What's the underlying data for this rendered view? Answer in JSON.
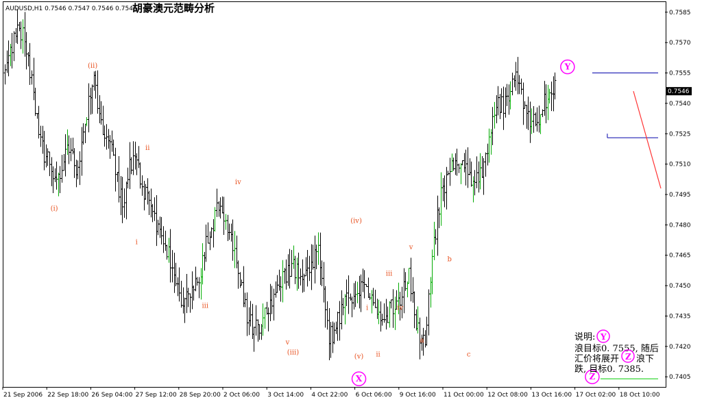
{
  "header": {
    "symbol_line": "AUDUSD,H1  0.7546 0.7547 0.7546 0.7546",
    "chinese_title": "胡豪澳元范畴分析"
  },
  "colors": {
    "background": "#ffffff",
    "bars": "#000000",
    "bull_bars": "#00aa00",
    "wave_labels": "#e8501e",
    "circle_labels": "#ff00ff",
    "box": "#0000aa",
    "forecast": "#ff3333",
    "target_line": "#00cc00"
  },
  "chart_data": {
    "type": "ohlc",
    "symbol": "AUDUSD",
    "timeframe": "H1",
    "ylim": [
      0.74,
      0.759
    ],
    "y_ticks": [
      "0.7585",
      "0.7570",
      "0.7555",
      "0.7540",
      "0.7525",
      "0.7510",
      "0.7495",
      "0.7480",
      "0.7465",
      "0.7450",
      "0.7435",
      "0.7420",
      "0.7405"
    ],
    "current_price": "0.7546",
    "x_ticks": [
      "21 Sep 2006",
      "22 Sep 18:00",
      "26 Sep 04:00",
      "27 Sep 12:00",
      "28 Sep 20:00",
      "2 Oct 06:00",
      "3 Oct 14:00",
      "4 Oct 22:00",
      "6 Oct 06:00",
      "9 Oct 16:00",
      "11 Oct 00:00",
      "12 Oct 08:00",
      "13 Oct 16:00",
      "17 Oct 02:00",
      "18 Oct 10:00"
    ],
    "bar_count": 310,
    "bull_color_note": "green bars mark up-closes",
    "price_path": [
      [
        0,
        0.7555
      ],
      [
        8,
        0.7575
      ],
      [
        14,
        0.7572
      ],
      [
        20,
        0.755
      ],
      [
        26,
        0.752
      ],
      [
        32,
        0.751
      ],
      [
        36,
        0.7498
      ],
      [
        40,
        0.7505
      ],
      [
        46,
        0.752
      ],
      [
        52,
        0.7505
      ],
      [
        58,
        0.753
      ],
      [
        64,
        0.7552
      ],
      [
        70,
        0.753
      ],
      [
        76,
        0.7522
      ],
      [
        82,
        0.75
      ],
      [
        86,
        0.7488
      ],
      [
        90,
        0.751
      ],
      [
        96,
        0.751
      ],
      [
        102,
        0.7495
      ],
      [
        108,
        0.7488
      ],
      [
        114,
        0.747
      ],
      [
        120,
        0.7465
      ],
      [
        124,
        0.745
      ],
      [
        130,
        0.7443
      ],
      [
        136,
        0.745
      ],
      [
        142,
        0.7456
      ],
      [
        146,
        0.747
      ],
      [
        150,
        0.7478
      ],
      [
        156,
        0.749
      ],
      [
        160,
        0.748
      ],
      [
        166,
        0.7468
      ],
      [
        172,
        0.745
      ],
      [
        176,
        0.7435
      ],
      [
        180,
        0.743
      ],
      [
        186,
        0.743
      ],
      [
        192,
        0.744
      ],
      [
        198,
        0.745
      ],
      [
        204,
        0.7455
      ],
      [
        210,
        0.7458
      ],
      [
        216,
        0.7455
      ],
      [
        222,
        0.746
      ],
      [
        228,
        0.747
      ],
      [
        232,
        0.7445
      ],
      [
        236,
        0.7425
      ],
      [
        240,
        0.7427
      ],
      [
        246,
        0.744
      ],
      [
        252,
        0.7445
      ],
      [
        258,
        0.745
      ],
      [
        264,
        0.7445
      ],
      [
        270,
        0.744
      ],
      [
        276,
        0.7432
      ],
      [
        282,
        0.744
      ],
      [
        288,
        0.7445
      ],
      [
        294,
        0.7458
      ],
      [
        300,
        0.743
      ],
      [
        306,
        0.742
      ],
      [
        312,
        0.747
      ],
      [
        318,
        0.7495
      ],
      [
        324,
        0.751
      ],
      [
        330,
        0.7512
      ],
      [
        336,
        0.7505
      ],
      [
        342,
        0.75
      ],
      [
        348,
        0.7505
      ],
      [
        354,
        0.753
      ],
      [
        360,
        0.754
      ],
      [
        366,
        0.754
      ],
      [
        372,
        0.7553
      ],
      [
        378,
        0.754
      ],
      [
        384,
        0.753
      ],
      [
        390,
        0.7535
      ],
      [
        396,
        0.7545
      ],
      [
        402,
        0.7548
      ]
    ],
    "wave_labels": [
      {
        "text": "(ii)",
        "t": 64,
        "y": 0.75575,
        "color": "orange"
      },
      {
        "text": "(i)",
        "t": 36,
        "y": 0.7487,
        "color": "orange"
      },
      {
        "text": "ii",
        "t": 104,
        "y": 0.7517,
        "color": "orange"
      },
      {
        "text": "i",
        "t": 96,
        "y": 0.74705,
        "color": "orange"
      },
      {
        "text": "iii",
        "t": 146,
        "y": 0.7439,
        "color": "orange"
      },
      {
        "text": "iv",
        "t": 170,
        "y": 0.75,
        "color": "orange"
      },
      {
        "text": "v",
        "t": 206,
        "y": 0.7421,
        "color": "orange"
      },
      {
        "text": "(iii)",
        "t": 210,
        "y": 0.7416,
        "color": "orange"
      },
      {
        "text": "(iv)",
        "t": 256,
        "y": 0.7481,
        "color": "orange"
      },
      {
        "text": "(v)",
        "t": 258,
        "y": 0.7414,
        "color": "orange"
      },
      {
        "text": "i",
        "t": 264,
        "y": 0.7438,
        "color": "orange"
      },
      {
        "text": "ii",
        "t": 272,
        "y": 0.7415,
        "color": "orange"
      },
      {
        "text": "iii",
        "t": 280,
        "y": 0.7455,
        "color": "orange"
      },
      {
        "text": "iv",
        "t": 288,
        "y": 0.7438,
        "color": "orange"
      },
      {
        "text": "v",
        "t": 296,
        "y": 0.7468,
        "color": "orange"
      },
      {
        "text": "a",
        "t": 304,
        "y": 0.7422,
        "color": "orange"
      },
      {
        "text": "b",
        "t": 324,
        "y": 0.7462,
        "color": "orange"
      },
      {
        "text": "c",
        "t": 338,
        "y": 0.7415,
        "color": "orange"
      }
    ],
    "circle_labels": [
      {
        "text": "Y",
        "t": 410,
        "y": 0.7558
      },
      {
        "text": "X",
        "t": 258,
        "y": 0.7404
      },
      {
        "text": "Z",
        "t": 428,
        "y": 0.7405
      }
    ],
    "box": {
      "t_start": 428,
      "t_end": 476,
      "y_top": 0.7555,
      "y_bottom": 0.7523
    },
    "forecast_line": {
      "from": [
        458,
        0.7546
      ],
      "to": [
        478,
        0.7498
      ]
    },
    "target_line": {
      "t_start": 434,
      "t_end": 476,
      "y": 0.7404
    }
  },
  "note": {
    "line1": "说明:",
    "line2": "浪目标0. 7555, 随后",
    "line3": "汇价将展开",
    "line3b": "浪下",
    "line4": "跌, 目标0. 7385.",
    "circle_y": "Y",
    "circle_z": "Z"
  },
  "price_tag": "0.7546"
}
